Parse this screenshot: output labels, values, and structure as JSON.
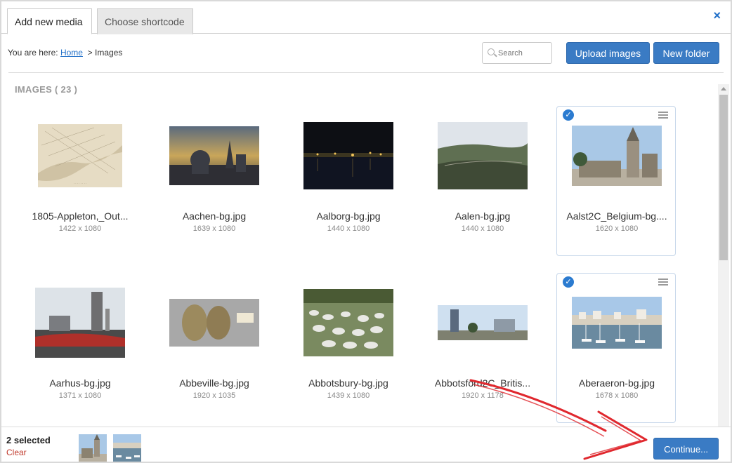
{
  "tabs": [
    {
      "label": "Add new media",
      "active": true
    },
    {
      "label": "Choose shortcode",
      "active": false
    }
  ],
  "close_icon": "×",
  "breadcrumb": {
    "prefix": "You are here:",
    "home": "Home",
    "separator": ">",
    "current": "Images"
  },
  "search": {
    "placeholder": "Search"
  },
  "buttons": {
    "upload": "Upload images",
    "new_folder": "New folder",
    "continue": "Continue..."
  },
  "section": {
    "title": "IMAGES ( 23 )"
  },
  "images": [
    {
      "name": "1805-Appleton,_Out...",
      "dims": "1422 x 1080",
      "selected": false,
      "thumb": "map"
    },
    {
      "name": "Aachen-bg.jpg",
      "dims": "1639 x 1080",
      "selected": false,
      "thumb": "cathedral-dusk"
    },
    {
      "name": "Aalborg-bg.jpg",
      "dims": "1440 x 1080",
      "selected": false,
      "thumb": "night-harbor"
    },
    {
      "name": "Aalen-bg.jpg",
      "dims": "1440 x 1080",
      "selected": false,
      "thumb": "valley"
    },
    {
      "name": "Aalst2C_Belgium-bg....",
      "dims": "1620 x 1080",
      "selected": true,
      "thumb": "belfry"
    },
    {
      "name": "Aarhus-bg.jpg",
      "dims": "1371 x 1080",
      "selected": false,
      "thumb": "industrial"
    },
    {
      "name": "Abbeville-bg.jpg",
      "dims": "1920 x 1035",
      "selected": false,
      "thumb": "stones"
    },
    {
      "name": "Abbotsbury-bg.jpg",
      "dims": "1439 x 1080",
      "selected": false,
      "thumb": "swans"
    },
    {
      "name": "Abbotsford2C_Britis...",
      "dims": "1920 x 1178",
      "selected": false,
      "thumb": "town"
    },
    {
      "name": "Aberaeron-bg.jpg",
      "dims": "1678 x 1080",
      "selected": true,
      "thumb": "harbor"
    }
  ],
  "footer": {
    "selected_text": "2 selected",
    "clear": "Clear"
  },
  "colors": {
    "accent": "#3a7bc4",
    "link": "#2371c9",
    "clear": "#c0392b",
    "check": "#2b7bd0",
    "arrow": "#e0282e"
  }
}
